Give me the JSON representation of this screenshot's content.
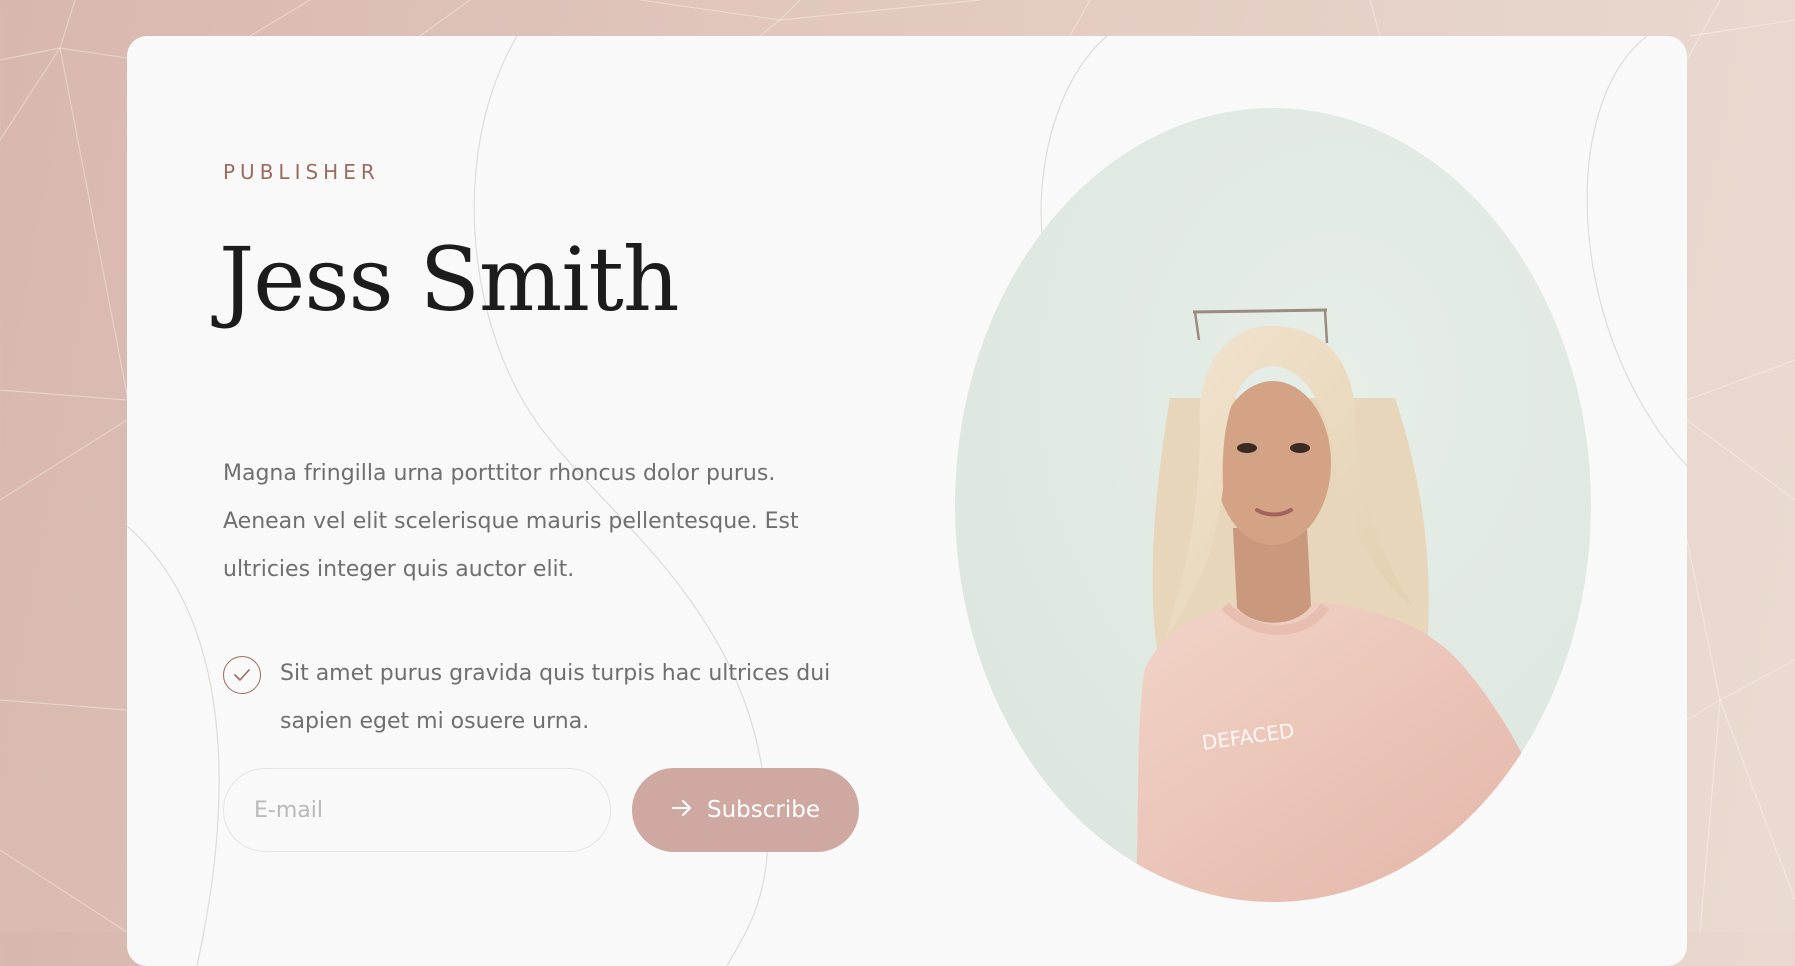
{
  "hero": {
    "eyebrow": "PUBLISHER",
    "title": "Jess Smith",
    "description": "Magna fringilla urna porttitor rhoncus dolor purus. Aenean vel elit scelerisque mauris pellentesque. Est ultricies integer quis auctor elit.",
    "feature": "Sit amet purus gravida quis turpis hac ultrices dui sapien eget mi osuere urna.",
    "feature_icon": "check-circle-icon"
  },
  "form": {
    "email_placeholder": "E-mail",
    "email_value": "",
    "subscribe_label": "Subscribe",
    "subscribe_icon": "arrow-right-icon"
  },
  "colors": {
    "accent": "#cfa8a1",
    "accent_text": "#9b6b61",
    "card_background": "#f9f9f9",
    "page_background": "#dcbcb2",
    "heading": "#1c1c1c",
    "body_text": "#6f6f6f"
  }
}
